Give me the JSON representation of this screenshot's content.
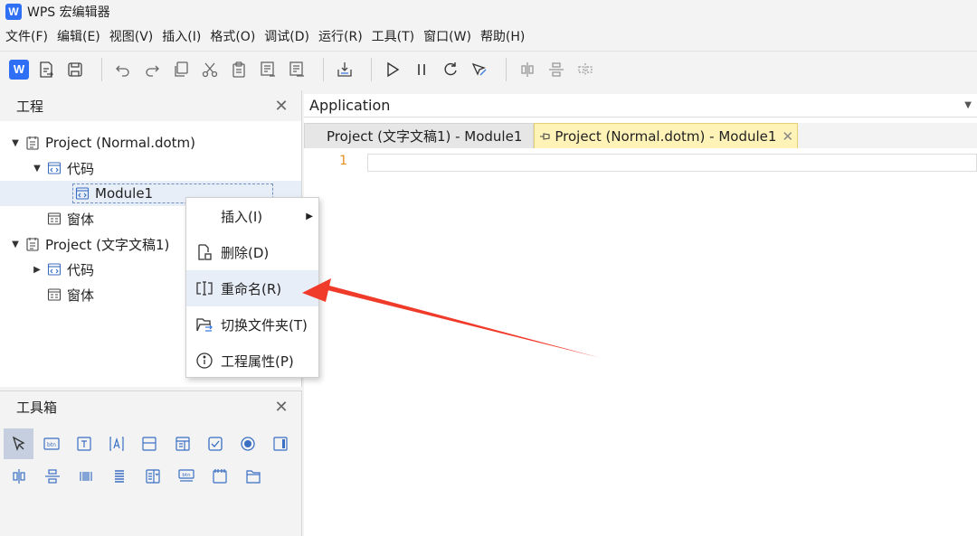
{
  "window": {
    "logo": "W",
    "title": "WPS 宏编辑器"
  },
  "menubar": {
    "items": [
      "文件(F)",
      "编辑(E)",
      "视图(V)",
      "插入(I)",
      "格式(O)",
      "调试(D)",
      "运行(R)",
      "工具(T)",
      "窗口(W)",
      "帮助(H)"
    ]
  },
  "toolbar": {
    "logo": "W",
    "icons": [
      "wps-logo-icon",
      "export-icon",
      "save-icon",
      "undo-icon",
      "redo-icon",
      "copy-icon",
      "cut-icon",
      "paste-icon",
      "indent-icon",
      "outdent-icon",
      "import-icon",
      "run-icon",
      "pause-icon",
      "reset-icon",
      "design-mode-icon",
      "align-horizontal-icon",
      "align-vertical-icon",
      "distribute-icon"
    ]
  },
  "project_panel": {
    "title": "工程",
    "close": "✕",
    "tree": [
      {
        "label": "Project (Normal.dotm)",
        "level": 0,
        "expanded": true
      },
      {
        "label": "代码",
        "level": 1,
        "expanded": true
      },
      {
        "label": "Module1",
        "level": 2,
        "selected": true
      },
      {
        "label": "窗体",
        "level": 1
      },
      {
        "label": "Project (文字文稿1)",
        "level": 0,
        "expanded": true
      },
      {
        "label": "代码",
        "level": 1,
        "expanded": false
      },
      {
        "label": "窗体",
        "level": 1
      }
    ]
  },
  "toolbox_panel": {
    "title": "工具箱",
    "close": "✕",
    "btn_label": "btn"
  },
  "editor": {
    "object_combo": "Application",
    "tabs": [
      {
        "label": "Project (文字文稿1) - Module1",
        "active": false
      },
      {
        "label": "Project (Normal.dotm) - Module1",
        "active": true,
        "close": "✕"
      }
    ],
    "line_numbers": [
      "1"
    ]
  },
  "context_menu": {
    "items": [
      {
        "label": "插入(I)",
        "submenu": true,
        "icon": null
      },
      {
        "label": "删除(D)",
        "icon": "delete-icon"
      },
      {
        "label": "重命名(R)",
        "icon": "rename-icon",
        "highlighted": true
      },
      {
        "label": "切换文件夹(T)",
        "icon": "toggle-folder-icon"
      },
      {
        "label": "工程属性(P)",
        "icon": "info-icon"
      }
    ]
  },
  "colors": {
    "accent": "#2f6ff6",
    "annotation_arrow": "#f03a2a",
    "active_tab": "#fff3b8",
    "line_number": "#e88d20"
  }
}
